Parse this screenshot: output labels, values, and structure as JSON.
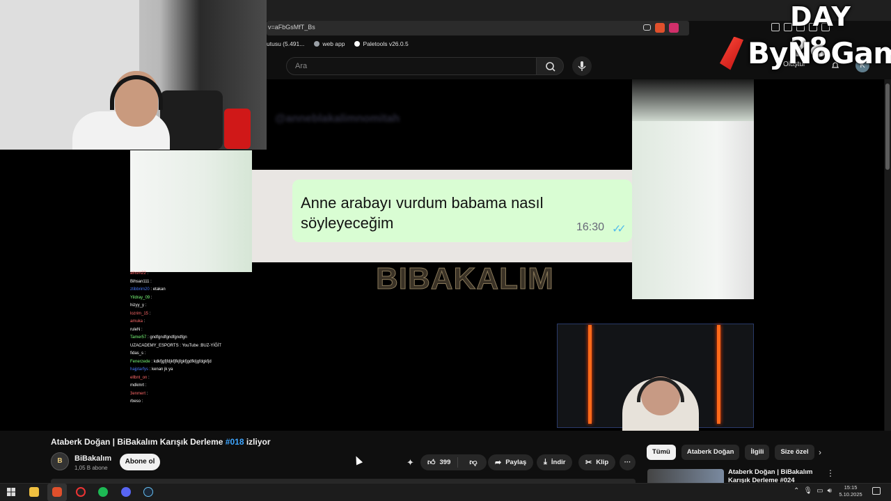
{
  "browser": {
    "address_text": "v=aFbGsMfT_Bs",
    "bookmarks": [
      {
        "label": "utusu (5.491..."
      },
      {
        "label": "web app"
      },
      {
        "label": "Paletools v26.0.5"
      }
    ]
  },
  "youtube_header": {
    "search_placeholder": "Ara",
    "create_label": "Oluştur",
    "avatar_letter": "K"
  },
  "overlay": {
    "day_label": "DAY 28",
    "brand": "ByNoGame"
  },
  "video": {
    "blurred_handle": "@anneblakalimnomitah",
    "chat_message": "Anne arabayı vurdum babama nasıl söyleyeceğim",
    "chat_time": "16:30",
    "ticks": "✓✓",
    "watermark": "BIBAKALIM",
    "chat_log": [
      {
        "user": "alnsm22",
        "msg": ""
      },
      {
        "user": "Bihsan111",
        "msg": ""
      },
      {
        "user": "ztibbrim20",
        "msg": "etakan"
      },
      {
        "user": "Yildray_09",
        "msg": ""
      },
      {
        "user": "hizyy_y",
        "msg": ""
      },
      {
        "user": "lozrim_15",
        "msg": ""
      },
      {
        "user": "amuka",
        "msg": ""
      },
      {
        "user": "ruleN",
        "msg": ""
      },
      {
        "user": "Tamer57",
        "msg": "gndfgndfgndfgndfgn"
      },
      {
        "user": "UZACADEMY_ESPORTS",
        "msg": "YouTube :BUZ-YİĞİT"
      },
      {
        "user": "fidas_s",
        "msg": ""
      },
      {
        "user": "Fenerzede",
        "msg": "kdkfjgfjfdjkfjfkjfgkfjgdfkljgfdgkfjd"
      },
      {
        "user": "hajptarfys",
        "msg": "kenan jk ya"
      },
      {
        "user": "ellbnt_on",
        "msg": ""
      },
      {
        "user": "mdkmrt",
        "msg": ""
      },
      {
        "user": "3enmert",
        "msg": ""
      },
      {
        "user": "rbeso",
        "msg": ""
      }
    ]
  },
  "watch": {
    "title_prefix": "Ataberk Doğan | BiBakalım Karışık Derleme",
    "title_tag": "#018",
    "title_suffix": "izliyor",
    "channel_name": "BiBakalım",
    "channel_subs": "1,05 B abone",
    "channel_initials": "B",
    "subscribe_label": "Abone ol",
    "like_count": "399",
    "share_label": "Paylaş",
    "download_label": "İndir",
    "clip_label": "Klip",
    "more_label": "···"
  },
  "sidebar": {
    "chips": [
      "Tümü",
      "Ataberk Doğan",
      "İlgili",
      "Size özel"
    ],
    "active_chip": "Tümü",
    "rec_title": "Ataberk Doğan | BiBakalım Karışık Derleme #024 izliyor"
  },
  "taskbar": {
    "time": "15:15",
    "date": "5.10.2025"
  },
  "colors": {
    "accent_link": "#3ea6ff",
    "background": "#0f0f0f",
    "chat_bubble": "#d9fdd3"
  }
}
